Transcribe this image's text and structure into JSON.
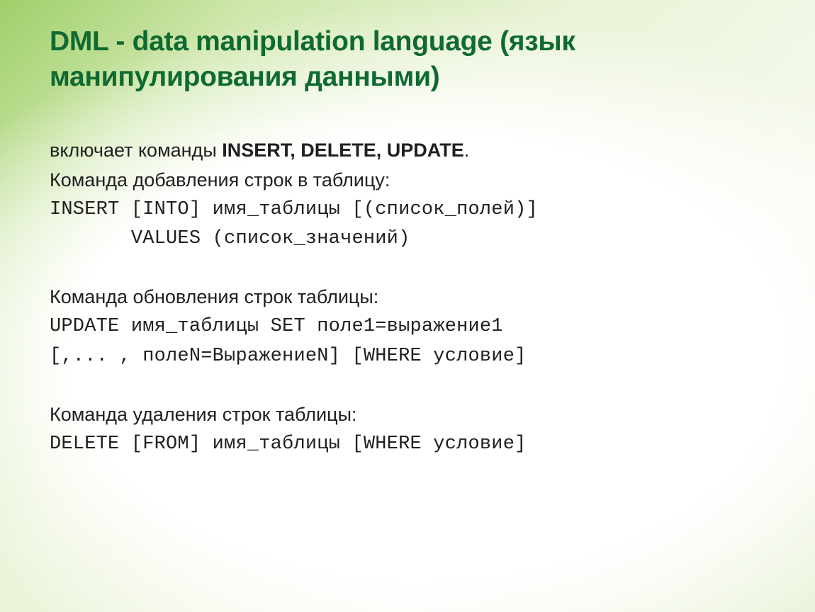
{
  "title": "DML - data manipulation language (язык манипулирования данными)",
  "intro": {
    "prefix": "включает команды ",
    "bold": "INSERT, DELETE, UPDATE",
    "suffix": "."
  },
  "sections": {
    "insert": {
      "label": "Команда добавления строк в таблицу:",
      "code1": "INSERT [INTO] имя_таблицы [(список_полей)]",
      "code2": "       VALUES (список_значений)"
    },
    "update": {
      "label": "Команда обновления строк таблицы:",
      "code1": "UPDATE имя_таблицы SET поле1=выражение1",
      "code2": "[,... , полеN=ВыражениеN] [WHERE условие]"
    },
    "delete": {
      "label": "Команда удаления строк таблицы:",
      "code1": "DELETE [FROM] имя_таблицы [WHERE условие]"
    }
  }
}
